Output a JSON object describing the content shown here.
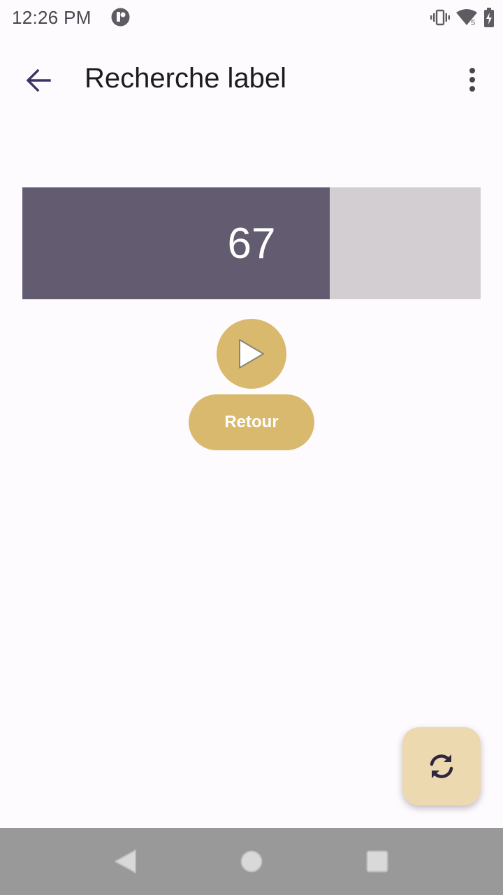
{
  "status_bar": {
    "time": "12:26 PM",
    "icons": [
      "app-notification-icon",
      "vibrate-icon",
      "wifi-icon",
      "battery-charging-icon"
    ],
    "wifi_badge": "5"
  },
  "app_bar": {
    "title": "Recherche label",
    "icons": [
      "back-arrow-icon",
      "more-vert-icon"
    ]
  },
  "progress": {
    "value_label": "67",
    "fill_fraction": 0.67,
    "fill_color": "#635b70",
    "track_color": "#d2ced2"
  },
  "controls": {
    "play_icon": "play-icon",
    "retour_label": "Retour",
    "accent_color": "#d8b96e"
  },
  "fab": {
    "icon": "refresh-icon",
    "color": "#ecd9b0"
  },
  "nav_bar": {
    "icons": [
      "nav-back-icon",
      "nav-home-icon",
      "nav-recents-icon"
    ]
  }
}
